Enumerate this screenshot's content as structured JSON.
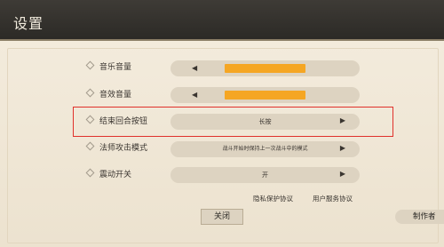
{
  "header": {
    "title": "设置"
  },
  "settings": [
    {
      "label": "音乐音量",
      "type": "slider",
      "level_percent": 65
    },
    {
      "label": "音效音量",
      "type": "slider",
      "level_percent": 65
    },
    {
      "label": "结束回合按钮",
      "type": "selector",
      "value": "长按"
    },
    {
      "label": "法师攻击模式",
      "type": "selector",
      "value": "战斗开始时保持上一次战斗中的模式"
    },
    {
      "label": "震动开关",
      "type": "selector",
      "value": "开"
    }
  ],
  "links": {
    "privacy": "隐私保护协议",
    "terms": "用户服务协议"
  },
  "buttons": {
    "close": "关闭",
    "credits": "制作者"
  },
  "colors": {
    "header_bg": "#3e3b36",
    "panel_bg": "#efe6d5",
    "slider_fill": "#f5a623",
    "highlight_border": "#e0312b"
  }
}
